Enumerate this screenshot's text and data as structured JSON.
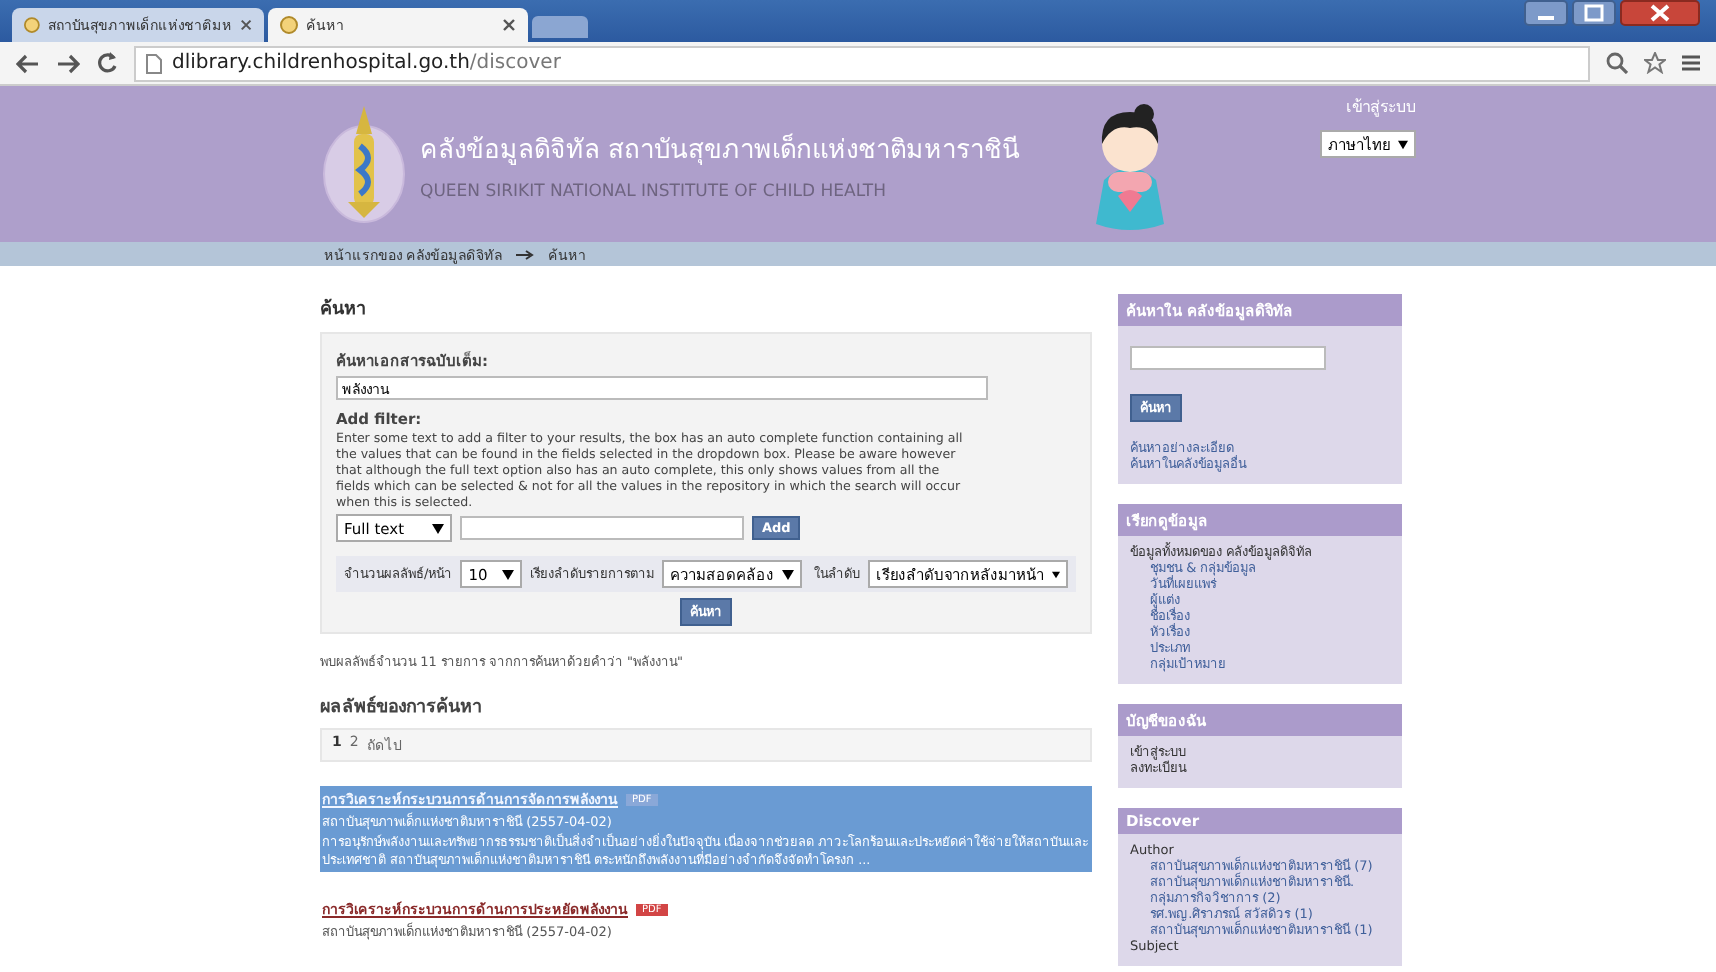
{
  "browser": {
    "tabs": [
      {
        "title": "สถาบันสุขภาพเด็กแห่งชาติมห",
        "selected": false
      },
      {
        "title": "ค้นหา",
        "selected": true
      }
    ],
    "url_host": "dlibrary.childrenhospital.go.th",
    "url_path": "/discover"
  },
  "header": {
    "title_th": "คลังข้อมูลดิจิทัล สถาบันสุขภาพเด็กแห่งชาติมหาราชินี",
    "title_en": "QUEEN SIRIKIT NATIONAL INSTITUTE OF CHILD HEALTH",
    "login": "เข้าสู่ระบบ",
    "language": "ภาษาไทย"
  },
  "breadcrumb": [
    "หน้าแรกของ คลังข้อมูลดิจิทัล",
    "ค้นหา"
  ],
  "search": {
    "heading": "ค้นหา",
    "query_label": "ค้นหาเอกสารฉบับเต็ม:",
    "query": "พลังงาน",
    "filter_label": "Add filter:",
    "filter_help": "Enter some text to add a filter to your results, the box has an auto complete function containing all the values that can be found in the fields selected in the dropdown box. Please be aware however that although the full text option also has an auto complete, this only shows values from all the fields which can be selected & not for all the values in the repository in which the search will occur when this is selected.",
    "filter_field": "Full text",
    "add_button": "Add",
    "rpp_label": "จำนวนผลลัพธ์/หน้า",
    "rpp": "10",
    "sort_label": "เรียงลำดับรายการตาม",
    "sort": "ความสอดคล้อง",
    "order_label": "ในลำดับ",
    "order": "เรียงลำดับจากหลังมาหน้า",
    "search_button": "ค้นหา"
  },
  "summary": "พบผลลัพธ์จำนวน 11 รายการ จากการค้นหาด้วยคำว่า \"พลังงาน\"",
  "results_heading": "ผลลัพธ์ของการค้นหา",
  "pagination": [
    {
      "label": "1",
      "selected": true
    },
    {
      "label": "2",
      "selected": false
    },
    {
      "label": "ถัดไป",
      "selected": false
    }
  ],
  "results": [
    {
      "title": "การวิเคราะห์กระบวนการด้านการจัดการพลังงาน",
      "badge": "PDF",
      "meta": "สถาบันสุขภาพเด็กแห่งชาติมหาราชินี (2557-04-02)",
      "abstract": "การอนุรักษ์พลังงานและทรัพยากรธรรมชาติเป็นสิ่งจำเป็นอย่างยิ่งในปัจจุบัน เนื่องจากช่วยลด ภาวะโลกร้อนและประหยัดค่าใช้จ่ายให้สถาบันและประเทศชาติ สถาบันสุขภาพเด็กแห่งชาติมหาราชินี ตระหนักถึงพลังงานที่มีอย่างจำกัดจึงจัดทำโครงก ...",
      "highlighted": true
    },
    {
      "title": "การวิเคราะห์กระบวนการด้านการประหยัดพลังงาน",
      "badge": "PDF",
      "meta": "สถาบันสุขภาพเด็กแห่งชาติมหาราชินี (2557-04-02)",
      "highlighted": false
    }
  ],
  "sidebar": [
    {
      "kind": "search",
      "title": "ค้นหาใน คลังข้อมูลดิจิทัล",
      "button": "ค้นหา",
      "links": [
        "ค้นหาอย่างละเอียด",
        "ค้นหาในคลังข้อมูลอื่น"
      ]
    },
    {
      "kind": "tree",
      "title": "เรียกดูข้อมูล",
      "items": [
        {
          "label": "ข้อมูลทั้งหมดของ คลังข้อมูลดิจิทัล",
          "children": [
            {
              "label": "ชุมชน & กลุ่มข้อมูล"
            },
            {
              "label": "วันที่เผยแพร่"
            },
            {
              "label": "ผู้แต่ง"
            },
            {
              "label": "ชื่อเรื่อง"
            },
            {
              "label": "หัวเรื่อง"
            },
            {
              "label": "ประเภท"
            },
            {
              "label": "กลุ่มเป้าหมาย"
            }
          ]
        }
      ]
    },
    {
      "kind": "tree",
      "title": "บัญชีของฉัน",
      "items": [
        {
          "label": "เข้าสู่ระบบ"
        },
        {
          "label": "ลงทะเบียน"
        }
      ]
    },
    {
      "kind": "tree",
      "title": "Discover",
      "items": [
        {
          "label": "Author",
          "children": [
            {
              "label": "สถาบันสุขภาพเด็กแห่งชาติมหาราชินี (7)"
            },
            {
              "label": "สถาบันสุขภาพเด็กแห่งชาติมหาราชินี."
            },
            {
              "label": "กลุ่มภารกิจวิชาการ (2)"
            },
            {
              "label": "รศ.พญ.ศิราภรณ์ สวัสดิวร (1)"
            },
            {
              "label": "สถาบันสุขภาพเด็กแห่งชาติมหาราชินี (1)"
            }
          ]
        },
        {
          "label": "Subject"
        }
      ]
    }
  ]
}
